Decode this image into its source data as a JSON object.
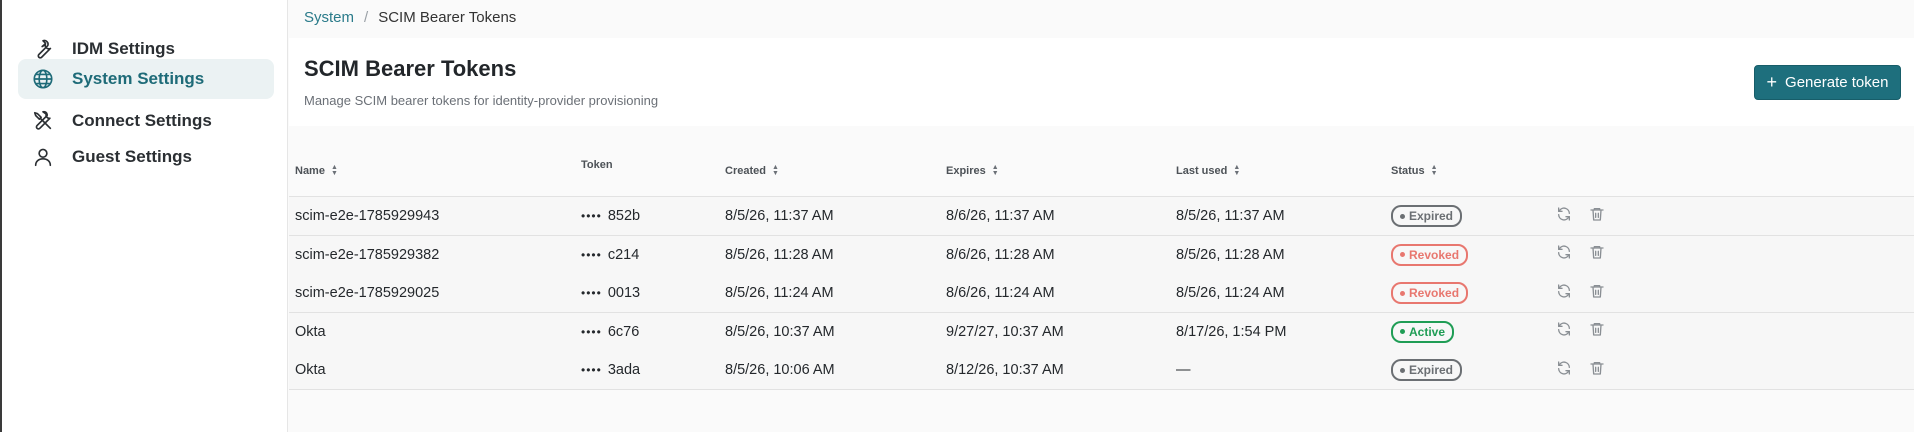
{
  "sidebar": {
    "items": [
      {
        "label": "IDM Settings",
        "icon": "wrench-icon",
        "active": false
      },
      {
        "label": "System Settings",
        "icon": "globe-icon",
        "active": true
      },
      {
        "label": "Connect Settings",
        "icon": "tools-icon",
        "active": false
      },
      {
        "label": "Guest Settings",
        "icon": "user-icon",
        "active": false
      }
    ]
  },
  "breadcrumb": {
    "parent": "System",
    "separator": "/",
    "current": "SCIM Bearer Tokens"
  },
  "header": {
    "title": "SCIM Bearer Tokens",
    "subtitle": "Manage SCIM bearer tokens for identity-provider provisioning",
    "generate_label": "Generate token"
  },
  "table": {
    "columns": {
      "name": "Name",
      "token": "Token",
      "created": "Created",
      "expires": "Expires",
      "last_used": "Last used",
      "status": "Status"
    },
    "rows": [
      {
        "name": "scim-e2e-1785929943",
        "token_mask": "••••",
        "token_suffix": "852b",
        "created": "8/5/26, 11:37 AM",
        "expires": "8/6/26, 11:37 AM",
        "last_used": "8/5/26, 11:37 AM",
        "status": "Expired"
      },
      {
        "name": "scim-e2e-1785929382",
        "token_mask": "••••",
        "token_suffix": "c214",
        "created": "8/5/26, 11:28 AM",
        "expires": "8/6/26, 11:28 AM",
        "last_used": "8/5/26, 11:28 AM",
        "status": "Revoked"
      },
      {
        "name": "scim-e2e-1785929025",
        "token_mask": "••••",
        "token_suffix": "0013",
        "created": "8/5/26, 11:24 AM",
        "expires": "8/6/26, 11:24 AM",
        "last_used": "8/5/26, 11:24 AM",
        "status": "Revoked"
      },
      {
        "name": "Okta",
        "token_mask": "••••",
        "token_suffix": "6c76",
        "created": "8/5/26, 10:37 AM",
        "expires": "9/27/27, 10:37 AM",
        "last_used": "8/17/26, 1:54 PM",
        "status": "Active"
      },
      {
        "name": "Okta",
        "token_mask": "••••",
        "token_suffix": "3ada",
        "created": "8/5/26, 10:06 AM",
        "expires": "8/12/26, 10:37 AM",
        "last_used": "—",
        "status": "Expired"
      }
    ]
  },
  "colors": {
    "accent": "#1e6f7d",
    "active_nav_bg": "#ebf2f3",
    "status_expired": "#6b6f73",
    "status_revoked": "#e8776f",
    "status_active": "#1f9d55"
  }
}
